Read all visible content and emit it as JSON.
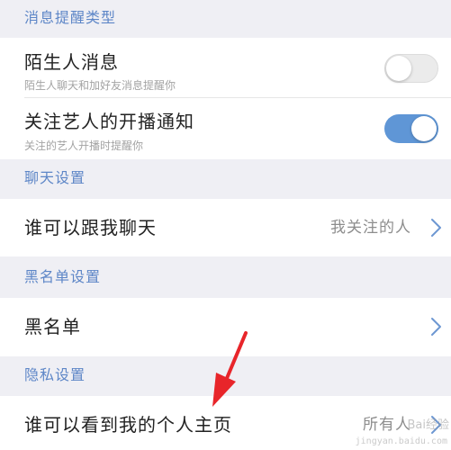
{
  "sections": {
    "notification_type": {
      "header": "消息提醒类型"
    },
    "chat": {
      "header": "聊天设置"
    },
    "blacklist": {
      "header": "黑名单设置"
    },
    "privacy": {
      "header": "隐私设置"
    }
  },
  "rows": {
    "stranger_messages": {
      "title": "陌生人消息",
      "subtitle": "陌生人聊天和加好友消息提醒你",
      "toggle_on": false
    },
    "artist_live": {
      "title": "关注艺人的开播通知",
      "subtitle": "关注的艺人开播时提醒你",
      "toggle_on": true
    },
    "who_can_chat": {
      "title": "谁可以跟我聊天",
      "value": "我关注的人"
    },
    "blacklist": {
      "title": "黑名单"
    },
    "who_can_see_profile": {
      "title": "谁可以看到我的个人主页",
      "value": "所有人"
    }
  },
  "icons": {
    "chevron": "chevron-right-icon",
    "annotation": "red-arrow"
  },
  "colors": {
    "accent": "#5f96d6",
    "section_header": "#5d86c7",
    "annotation_arrow": "#e8252a"
  },
  "watermark": {
    "text": "Bai经验",
    "sub": "jingyan.baidu.com"
  }
}
